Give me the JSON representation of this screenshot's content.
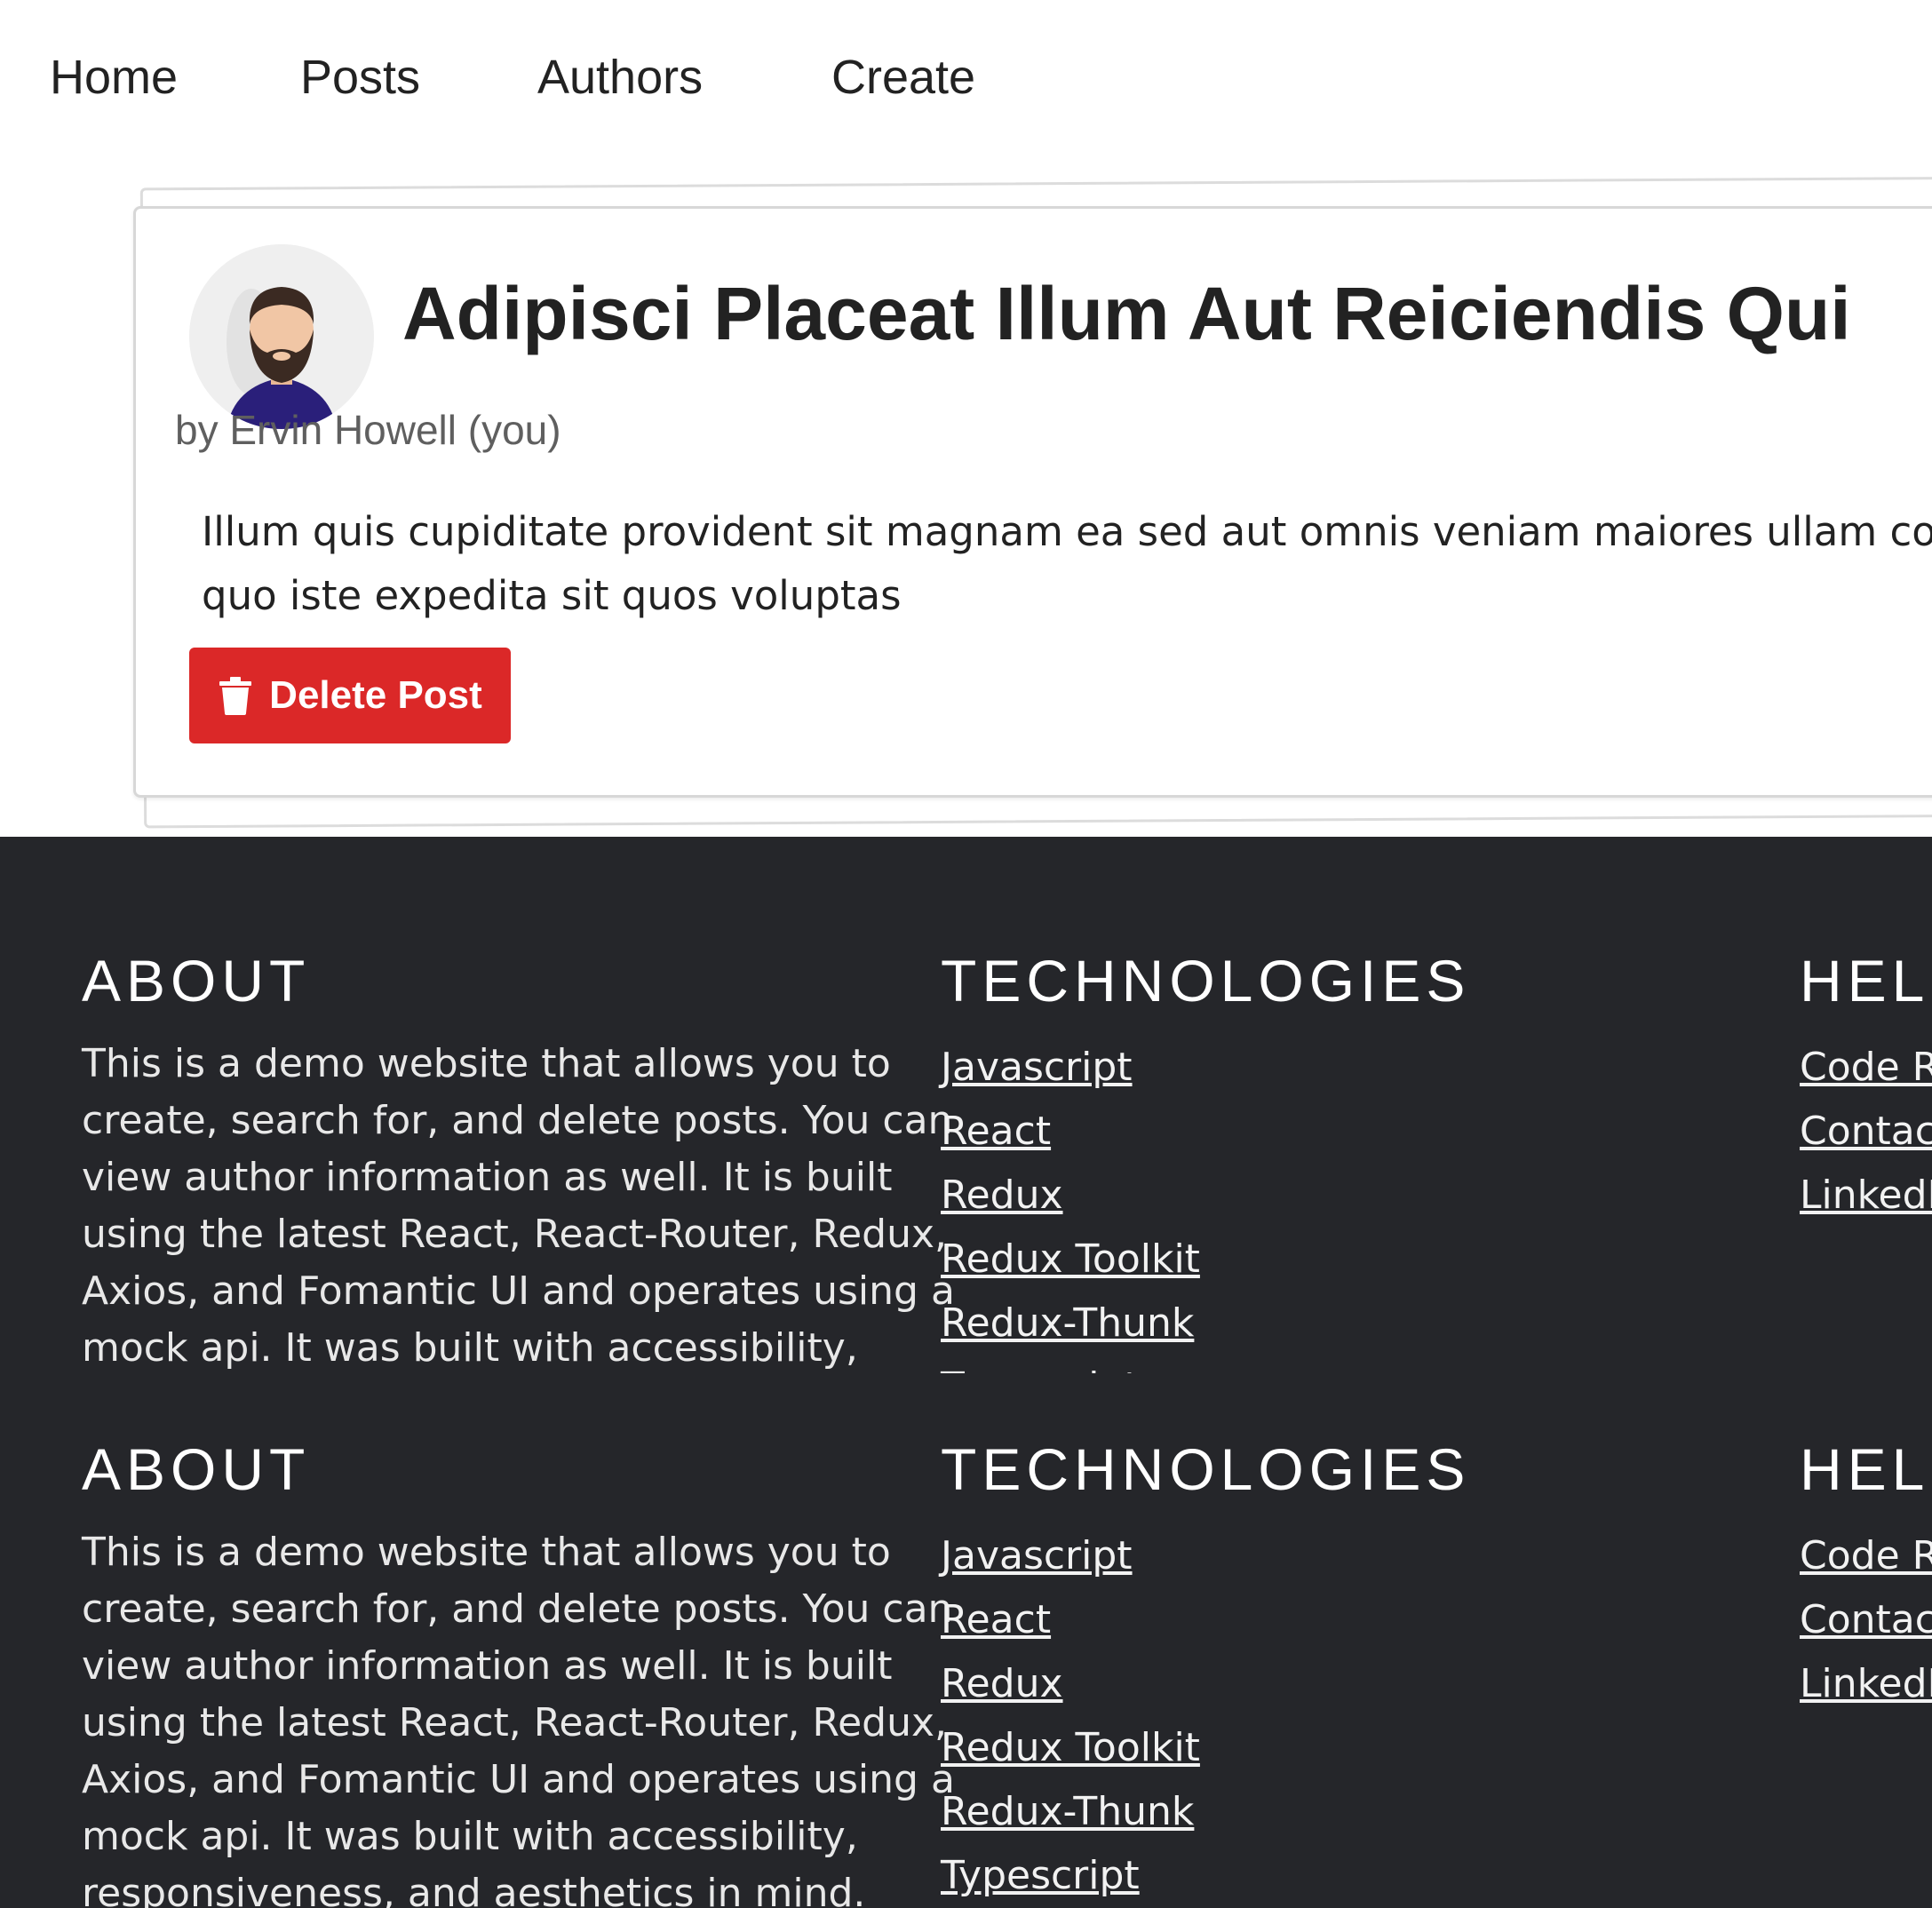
{
  "nav": {
    "items": [
      "Home",
      "Posts",
      "Authors",
      "Create"
    ]
  },
  "post": {
    "title": "Adipisci Placeat Illum Aut Reiciendis Qui",
    "author": "by Ervin Howell (you)",
    "body_lines": [
      "Illum quis cupiditate provident sit magnam ea sed aut omnis veniam maiores ullam cons",
      "quo iste expedita sit quos voluptas"
    ],
    "delete_label": "Delete Post",
    "delete_color": "#db2828"
  },
  "footer": {
    "background": "#25262a",
    "about": {
      "heading": "ABOUT",
      "lines": [
        "This is a demo website that allows you to",
        "create, search for, and delete posts. You can",
        "view author information as well. It is built",
        "using the latest React, React-Router, Redux,",
        "Axios, and Fomantic UI and operates using a",
        "mock api. It was built with accessibility,",
        "responsiveness, and aesthetics in mind."
      ]
    },
    "technologies": {
      "heading": "TECHNOLOGIES",
      "links": [
        "Javascript",
        "React",
        "Redux",
        "Redux Toolkit",
        "Redux-Thunk",
        "Typescript"
      ]
    },
    "help": {
      "heading": "HELP",
      "links": [
        "Code Re",
        "Contact",
        "LinkedIn"
      ]
    }
  }
}
